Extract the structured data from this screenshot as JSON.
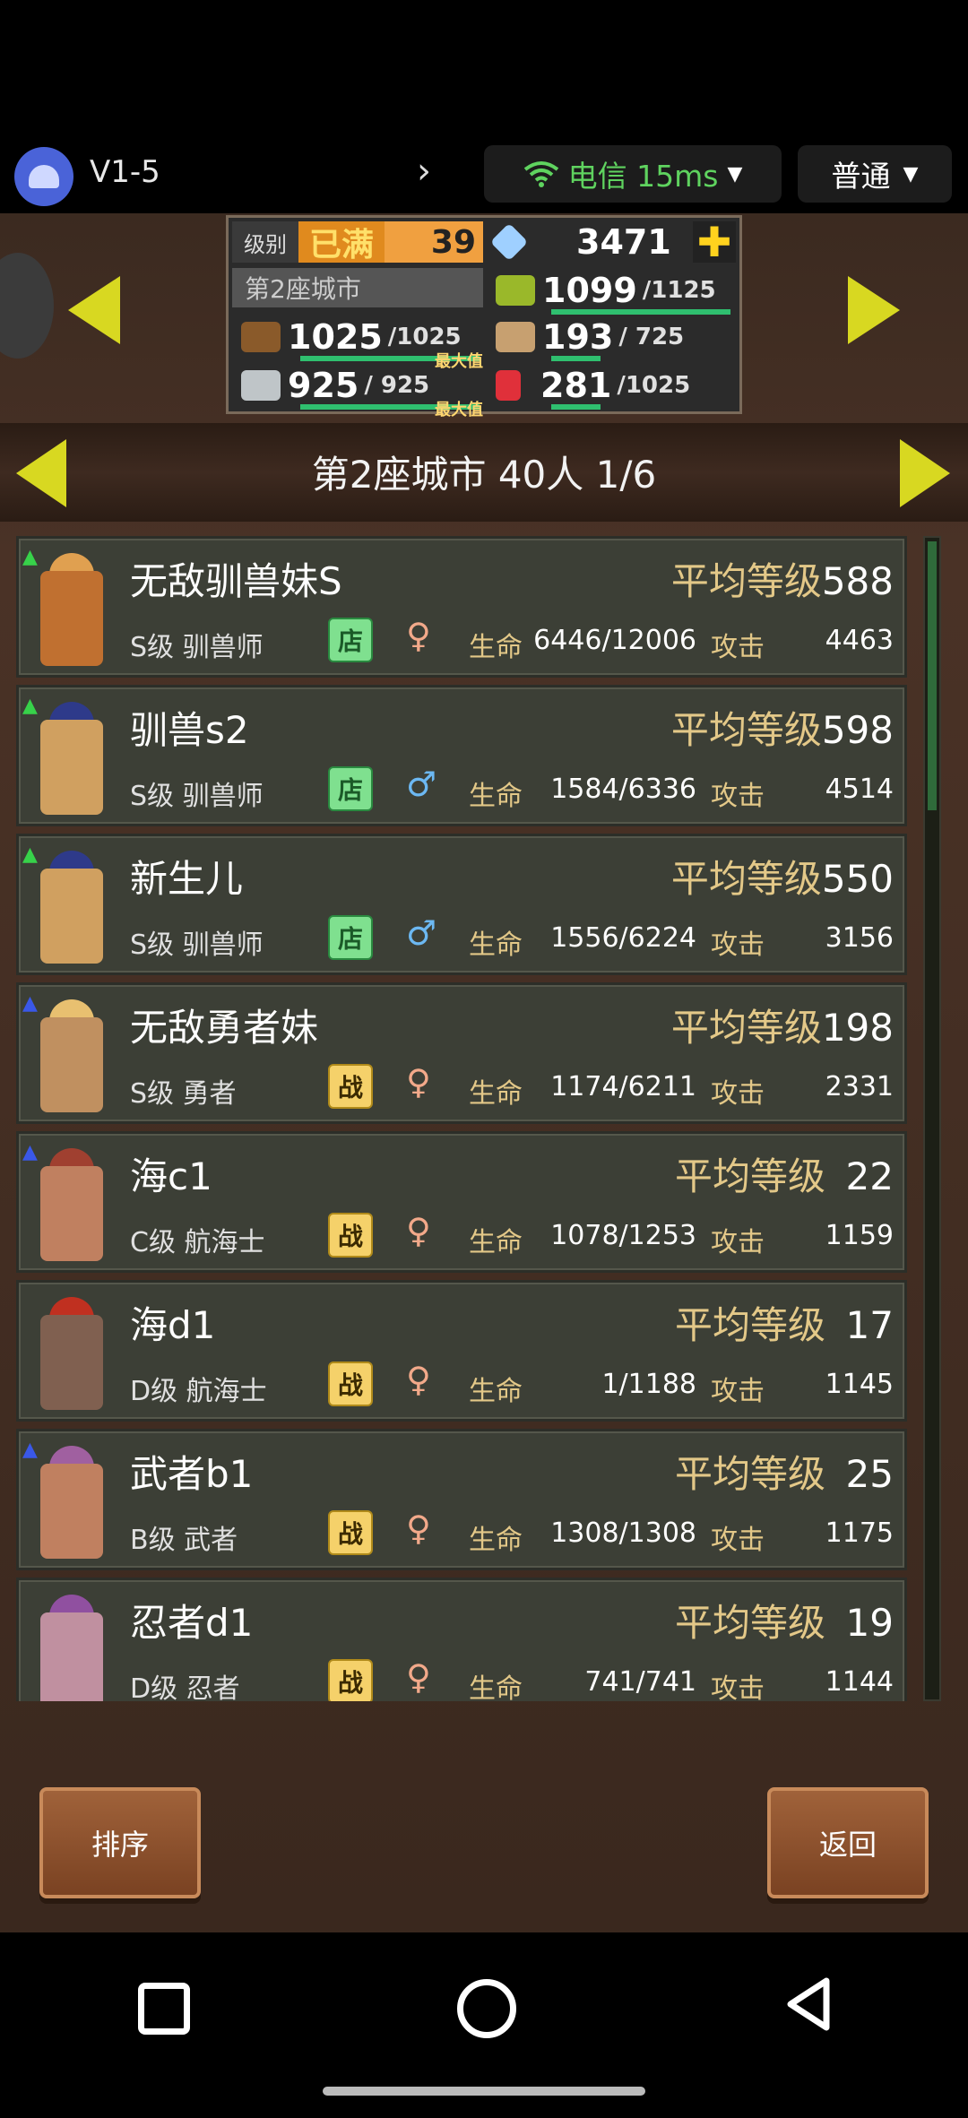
{
  "topbar": {
    "app_name": "V1-5",
    "network": "电信 15ms",
    "mode": "普通"
  },
  "hud": {
    "level_label": "级别",
    "level_status": "已满",
    "level": "39",
    "city_name": "第2座城市",
    "gems": "3471",
    "food": "1099",
    "food_max": "/1125",
    "wood": "1025",
    "wood_max": "/1025",
    "pop": "193",
    "pop_max": "/ 725",
    "ore": "925",
    "ore_max": "/ 925",
    "ruby": "281",
    "ruby_max": "/1025",
    "max_tag": "最大值",
    "plus": "✚"
  },
  "title": "第2座城市  40人 1/6",
  "labels": {
    "avg_level": "平均等级",
    "hp": "生命",
    "atk": "攻击"
  },
  "units": [
    {
      "name": "无敌驯兽妹S",
      "rank": "S级 驯兽师",
      "badge": "店",
      "gender": "♀",
      "hp": "6446/12006",
      "atk": "4463",
      "avg": "588"
    },
    {
      "name": "驯兽s2",
      "rank": "S级 驯兽师",
      "badge": "店",
      "gender": "♂",
      "hp": "1584/6336",
      "atk": "4514",
      "avg": "598"
    },
    {
      "name": "新生儿",
      "rank": "S级 驯兽师",
      "badge": "店",
      "gender": "♂",
      "hp": "1556/6224",
      "atk": "3156",
      "avg": "550"
    },
    {
      "name": "无敌勇者妹",
      "rank": "S级 勇者",
      "badge": "战",
      "gender": "♀",
      "hp": "1174/6211",
      "atk": "2331",
      "avg": "198"
    },
    {
      "name": "海c1",
      "rank": "C级 航海士",
      "badge": "战",
      "gender": "♀",
      "hp": "1078/1253",
      "atk": "1159",
      "avg": "22"
    },
    {
      "name": "海d1",
      "rank": "D级 航海士",
      "badge": "战",
      "gender": "♀",
      "hp": "1/1188",
      "atk": "1145",
      "avg": "17"
    },
    {
      "name": "武者b1",
      "rank": "B级 武者",
      "badge": "战",
      "gender": "♀",
      "hp": "1308/1308",
      "atk": "1175",
      "avg": "25"
    },
    {
      "name": "忍者d1",
      "rank": "D级 忍者",
      "badge": "战",
      "gender": "♀",
      "hp": "741/741",
      "atk": "1144",
      "avg": "19"
    }
  ],
  "buttons": {
    "sort": "排序",
    "back": "返回"
  },
  "colors": {
    "accent_yellow": "#d8d821",
    "hp_bar": "#2fbf6f",
    "network_green": "#5fd35f"
  }
}
